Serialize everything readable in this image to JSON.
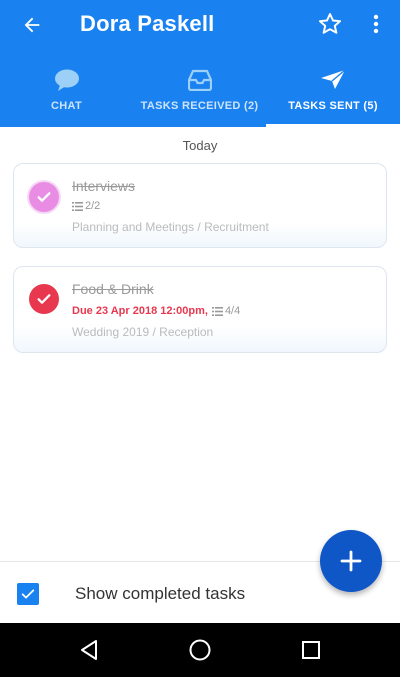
{
  "header": {
    "title": "Dora Paskell",
    "icons": {
      "back": "arrow-left-icon",
      "favorite": "star-outline-icon",
      "more": "more-vertical-icon"
    },
    "color": "#1a82f0"
  },
  "tabs": [
    {
      "label": "CHAT",
      "icon": "chat-bubble-icon",
      "selected": false
    },
    {
      "label": "TASKS RECEIVED (2)",
      "icon": "inbox-tray-icon",
      "selected": false
    },
    {
      "label": "TASKS SENT (5)",
      "icon": "paper-plane-icon",
      "selected": true
    }
  ],
  "day_header": "Today",
  "tasks": [
    {
      "title": "Interviews",
      "completed": true,
      "subtasks": "2/2",
      "path": "Planning and Meetings / Recruitment",
      "check_color": "#e88ce4"
    },
    {
      "title": "Food & Drink",
      "completed": true,
      "due": "Due 23 Apr 2018 12:00pm,",
      "subtasks": "4/4",
      "path": "Wedding 2019 / Reception",
      "check_color": "#e8384f"
    }
  ],
  "footer": {
    "show_completed_label": "Show completed tasks",
    "show_completed_checked": true
  },
  "fab": {
    "icon": "plus-icon",
    "color": "#0f56c7"
  },
  "system_nav": {
    "back": "triangle-back-icon",
    "home": "circle-home-icon",
    "recents": "square-recents-icon"
  }
}
